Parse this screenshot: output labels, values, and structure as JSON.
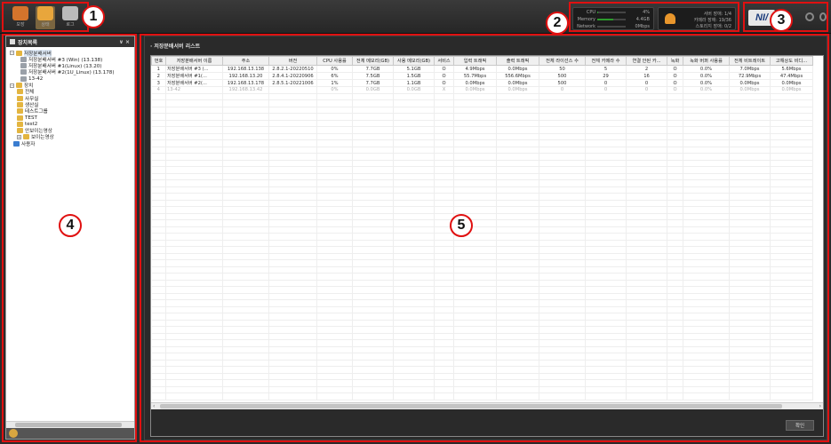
{
  "nav": {
    "items": [
      {
        "label": "모장",
        "icon": "settings-box-icon",
        "color": "#d4742c"
      },
      {
        "label": "상태",
        "icon": "status-chart-icon",
        "color": "#e8a63c"
      },
      {
        "label": "로그",
        "icon": "log-page-icon",
        "color": "#bbbbbb"
      }
    ]
  },
  "stats": {
    "rows": [
      {
        "key": "CPU",
        "value": "4%",
        "fraction": 0.04
      },
      {
        "key": "Memory",
        "value": "4.4GB",
        "fraction": 0.55
      },
      {
        "key": "Network",
        "value": "0Mbps",
        "fraction": 0.0
      }
    ]
  },
  "alarms": {
    "lines": [
      "서버 장애: 1/4",
      "카메라 장애: 19/36",
      "스토리지 장애: 0/2"
    ]
  },
  "logo": {
    "text": "NI/"
  },
  "tree_panel": {
    "title": "장치목록",
    "controls": "∨ ×",
    "nodes": [
      {
        "label": "저장분배서버",
        "type": "folder",
        "expander": "−"
      },
      {
        "label": "저장분배서버 #3 (Win) (13.138)",
        "type": "server"
      },
      {
        "label": "저장분배서버 #1(Linux) (13.20)",
        "type": "server"
      },
      {
        "label": "저장분배서버 #2(1U_Linux) (13.178)",
        "type": "server"
      },
      {
        "label": "13-42",
        "type": "server"
      },
      {
        "label": "장치",
        "type": "folder",
        "expander": "−"
      },
      {
        "label": "전체",
        "type": "folder"
      },
      {
        "label": "사무실",
        "type": "folder"
      },
      {
        "label": "생산실",
        "type": "folder"
      },
      {
        "label": "테스트그룹",
        "type": "folder"
      },
      {
        "label": "TEST",
        "type": "folder"
      },
      {
        "label": "test2",
        "type": "folder"
      },
      {
        "label": "안보이는영상",
        "type": "folder"
      },
      {
        "label": "보이는영상",
        "type": "folder",
        "expander": "+"
      },
      {
        "label": "사용자",
        "type": "user"
      }
    ]
  },
  "grid": {
    "title": "· 저장분배서버 리스트",
    "columns": [
      "번호",
      "저장분배서버 이름",
      "주소",
      "버전",
      "CPU 사용률",
      "전체 메모리(GB)",
      "사용 메모리(GB)",
      "서비스",
      "입력 트래픽",
      "출력 트래픽",
      "전체 라이선스 수",
      "전체 카메라 수",
      "연결 안된 카...",
      "녹화",
      "녹화 버퍼 사용률",
      "전체 비트레이트",
      "고해상도 비디..."
    ],
    "rows": [
      [
        "1",
        "저장분배서버 #3 (...",
        "192.168.13.138",
        "2.8.2.1-20220510",
        "0%",
        "7.7GB",
        "5.1GB",
        "O",
        "4.9Mbps",
        "0.0Mbps",
        "50",
        "5",
        "2",
        "O",
        "0.0%",
        "7.0Mbps",
        "5.6Mbps"
      ],
      [
        "2",
        "저장분배서버 #1(...",
        "192.168.13.20",
        "2.8.4.1-20220906",
        "6%",
        "7.5GB",
        "1.5GB",
        "O",
        "55.7Mbps",
        "556.6Mbps",
        "500",
        "29",
        "16",
        "O",
        "0.0%",
        "72.9Mbps",
        "47.4Mbps"
      ],
      [
        "3",
        "저장분배서버 #2(...",
        "192.168.13.178",
        "2.8.5.1-20221006",
        "1%",
        "7.7GB",
        "1.1GB",
        "O",
        "0.0Mbps",
        "0.0Mbps",
        "500",
        "0",
        "0",
        "O",
        "0.0%",
        "0.0Mbps",
        "0.0Mbps"
      ],
      [
        "4",
        "13-42",
        "192.168.13.42",
        "",
        "0%",
        "0.0GB",
        "0.0GB",
        "X",
        "0.0Mbps",
        "0.0Mbps",
        "0",
        "0",
        "0",
        "O",
        "0.0%",
        "0.0Mbps",
        "0.0Mbps"
      ]
    ],
    "confirm_label": "확인"
  },
  "annotations": [
    "1",
    "2",
    "3",
    "4",
    "5"
  ]
}
